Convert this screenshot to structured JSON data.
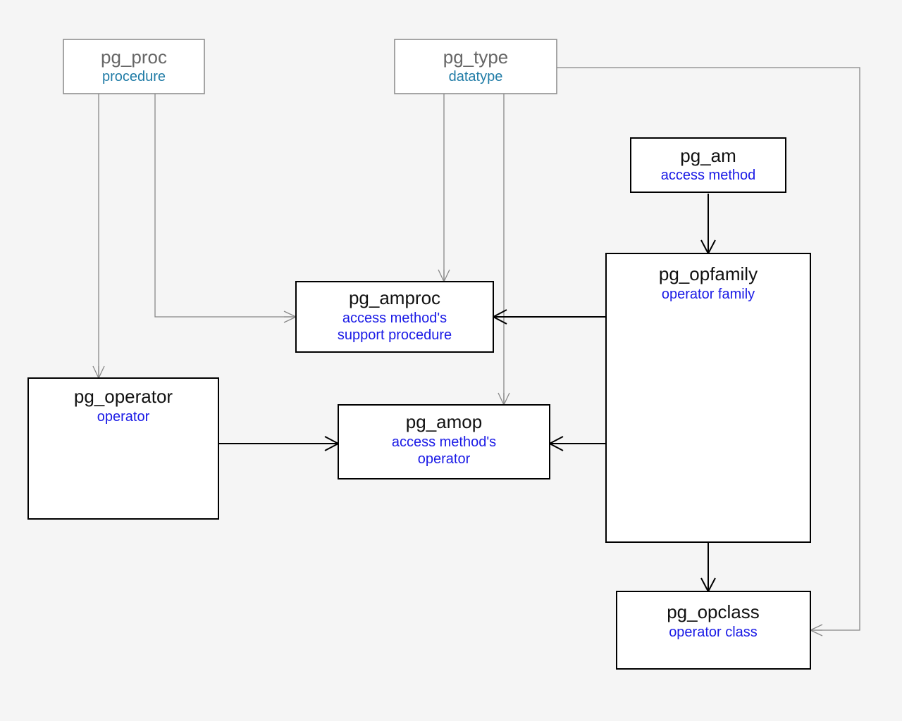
{
  "entities": {
    "pg_proc": {
      "title": "pg_proc",
      "subtitle": "procedure"
    },
    "pg_type": {
      "title": "pg_type",
      "subtitle": "datatype"
    },
    "pg_am": {
      "title": "pg_am",
      "subtitle": "access method"
    },
    "pg_opfamily": {
      "title": "pg_opfamily",
      "subtitle": "operator family"
    },
    "pg_operator": {
      "title": "pg_operator",
      "subtitle": "operator"
    },
    "pg_amproc": {
      "title": "pg_amproc",
      "subtitle1": "access method's",
      "subtitle2": "support procedure"
    },
    "pg_amop": {
      "title": "pg_amop",
      "subtitle1": "access method's",
      "subtitle2": "operator"
    },
    "pg_opclass": {
      "title": "pg_opclass",
      "subtitle": "operator class"
    }
  },
  "relationships": [
    {
      "from": "pg_proc",
      "to": "pg_operator",
      "via": "direct"
    },
    {
      "from": "pg_proc",
      "to": "pg_amproc",
      "via": "elbow"
    },
    {
      "from": "pg_type",
      "to": "pg_amproc",
      "via": "direct"
    },
    {
      "from": "pg_type",
      "to": "pg_amop",
      "via": "direct"
    },
    {
      "from": "pg_type",
      "to": "pg_opclass",
      "via": "far-elbow"
    },
    {
      "from": "pg_am",
      "to": "pg_opfamily",
      "via": "direct"
    },
    {
      "from": "pg_opfamily",
      "to": "pg_amproc",
      "via": "direct"
    },
    {
      "from": "pg_opfamily",
      "to": "pg_amop",
      "via": "direct"
    },
    {
      "from": "pg_opfamily",
      "to": "pg_opclass",
      "via": "direct"
    },
    {
      "from": "pg_operator",
      "to": "pg_amop",
      "via": "direct"
    }
  ]
}
